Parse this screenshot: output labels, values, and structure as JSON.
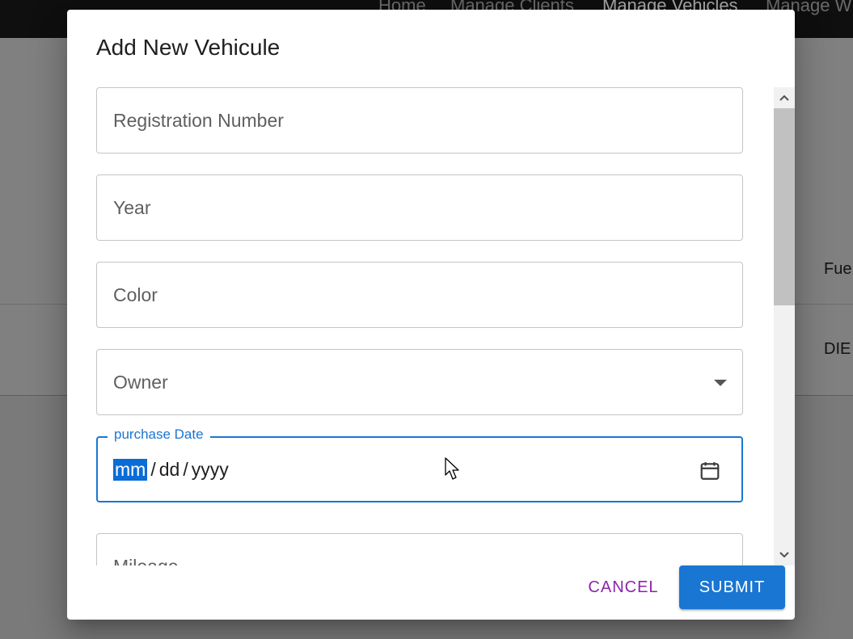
{
  "background": {
    "nav": {
      "items": [
        {
          "label": "Home"
        },
        {
          "label": "Manage Clients"
        },
        {
          "label": "Manage Vehicles",
          "active": true
        },
        {
          "label": "Manage W"
        }
      ]
    },
    "table": {
      "header_partial": "Fue",
      "row_partial": "DIE"
    }
  },
  "dialog": {
    "title": "Add New Vehicule",
    "fields": {
      "registration_number": {
        "placeholder": "Registration Number",
        "value": ""
      },
      "year": {
        "placeholder": "Year",
        "value": ""
      },
      "color": {
        "placeholder": "Color",
        "value": ""
      },
      "owner": {
        "placeholder": "Owner",
        "value": "",
        "type": "select"
      },
      "purchase_date": {
        "label": "purchase Date",
        "segments": {
          "month": "mm",
          "day": "dd",
          "year": "yyyy"
        },
        "separator": "/",
        "selected_segment": "month",
        "focused": true
      },
      "mileage": {
        "placeholder": "Mileage",
        "value": ""
      }
    },
    "actions": {
      "cancel_label": "CANCEL",
      "submit_label": "SUBMIT"
    }
  },
  "icons": {
    "calendar": "calendar-icon",
    "select_arrow": "caret-down-icon",
    "scroll_up": "chevron-up-icon",
    "scroll_down": "chevron-down-icon",
    "cursor": "mouse-pointer-icon"
  },
  "colors": {
    "primary": "#1976d2",
    "cancel_text": "#8e24aa",
    "overlay": "#7a7a7a",
    "app_bar": "#0f0f0f"
  }
}
